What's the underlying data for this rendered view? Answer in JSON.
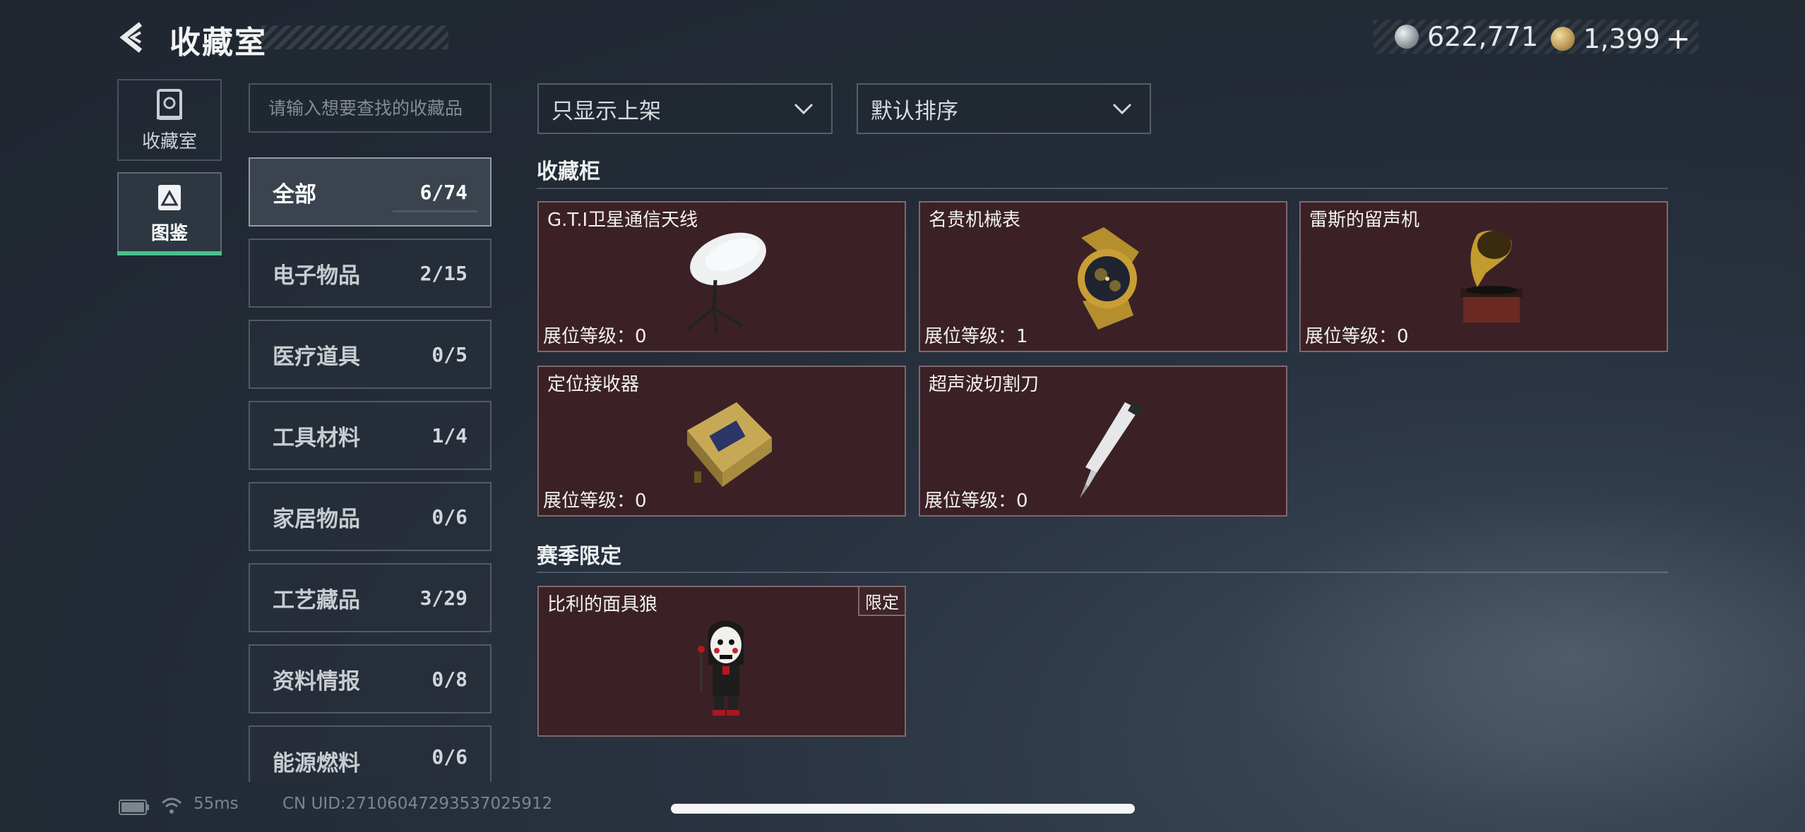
{
  "header": {
    "title": "收藏室",
    "currency": {
      "silver": "622,771",
      "gold": "1,399",
      "plus": "+"
    }
  },
  "nav": [
    {
      "label": "收藏室",
      "icon": "cabinet-icon",
      "active": false
    },
    {
      "label": "图鉴",
      "icon": "codex-icon",
      "active": true
    }
  ],
  "search": {
    "placeholder": "请输入想要查找的收藏品"
  },
  "categories": [
    {
      "name": "全部",
      "count": "6/74",
      "active": true
    },
    {
      "name": "电子物品",
      "count": "2/15"
    },
    {
      "name": "医疗道具",
      "count": "0/5"
    },
    {
      "name": "工具材料",
      "count": "1/4"
    },
    {
      "name": "家居物品",
      "count": "0/6"
    },
    {
      "name": "工艺藏品",
      "count": "3/29"
    },
    {
      "name": "资料情报",
      "count": "0/8"
    },
    {
      "name": "能源燃料",
      "count": "0/6"
    }
  ],
  "filters": {
    "show": "只显示上架",
    "sort": "默认排序"
  },
  "sections": {
    "cabinet": {
      "title": "收藏柜",
      "items": [
        {
          "name": "G.T.I卫星通信天线",
          "level": "展位等级：0",
          "icon": "satellite-dish-icon"
        },
        {
          "name": "名贵机械表",
          "level": "展位等级：1",
          "icon": "watch-icon"
        },
        {
          "name": "雷斯的留声机",
          "level": "展位等级：0",
          "icon": "gramophone-icon"
        },
        {
          "name": "定位接收器",
          "level": "展位等级：0",
          "icon": "receiver-icon"
        },
        {
          "name": "超声波切割刀",
          "level": "展位等级：0",
          "icon": "cutter-icon"
        }
      ]
    },
    "season": {
      "title": "赛季限定",
      "items": [
        {
          "name": "比利的面具狼",
          "badge": "限定",
          "icon": "puppet-icon"
        }
      ]
    }
  },
  "footer": {
    "ping": "55ms",
    "uid": "CN UID:27106047293537025912"
  },
  "colors": {
    "accent": "#49c08a",
    "card_bg": "#3b2126"
  }
}
